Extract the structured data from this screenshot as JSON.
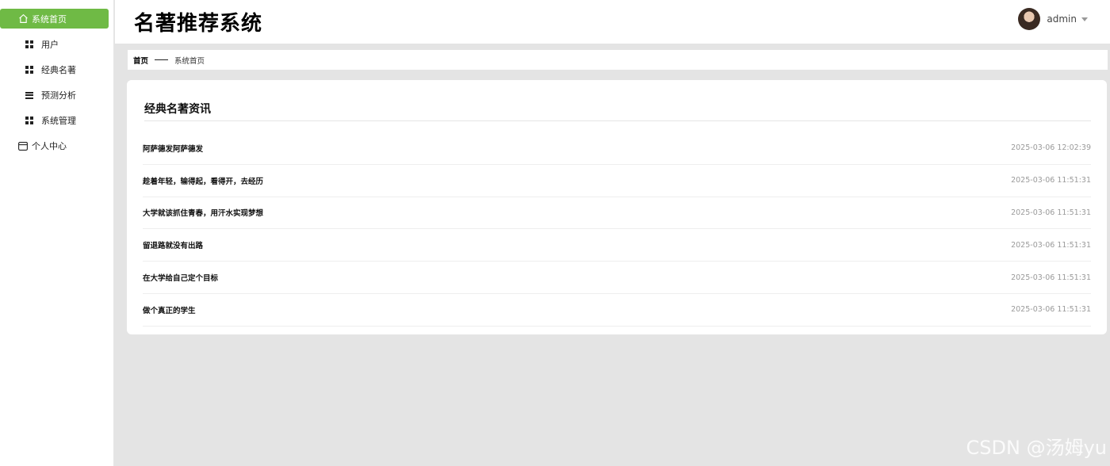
{
  "app": {
    "title": "名著推荐系统"
  },
  "user": {
    "name": "admin"
  },
  "sidebar": {
    "items": [
      {
        "label": "系统首页"
      },
      {
        "label": "用户"
      },
      {
        "label": "经典名著"
      },
      {
        "label": "预测分析"
      },
      {
        "label": "系统管理"
      },
      {
        "label": "个人中心"
      }
    ]
  },
  "breadcrumb": {
    "home": "首页",
    "current": "系统首页"
  },
  "news": {
    "title": "经典名著资讯",
    "items": [
      {
        "title": "阿萨德发阿萨德发",
        "time": "2025-03-06 12:02:39"
      },
      {
        "title": "趁着年轻，输得起，看得开，去经历",
        "time": "2025-03-06 11:51:31"
      },
      {
        "title": "大学就该抓住青春，用汗水实现梦想",
        "time": "2025-03-06 11:51:31"
      },
      {
        "title": "留退路就没有出路",
        "time": "2025-03-06 11:51:31"
      },
      {
        "title": "在大学给自己定个目标",
        "time": "2025-03-06 11:51:31"
      },
      {
        "title": "做个真正的学生",
        "time": "2025-03-06 11:51:31"
      }
    ]
  },
  "watermark": "CSDN @汤姆yu",
  "colors": {
    "accent": "#6fba45",
    "background": "#e4e4e4"
  }
}
